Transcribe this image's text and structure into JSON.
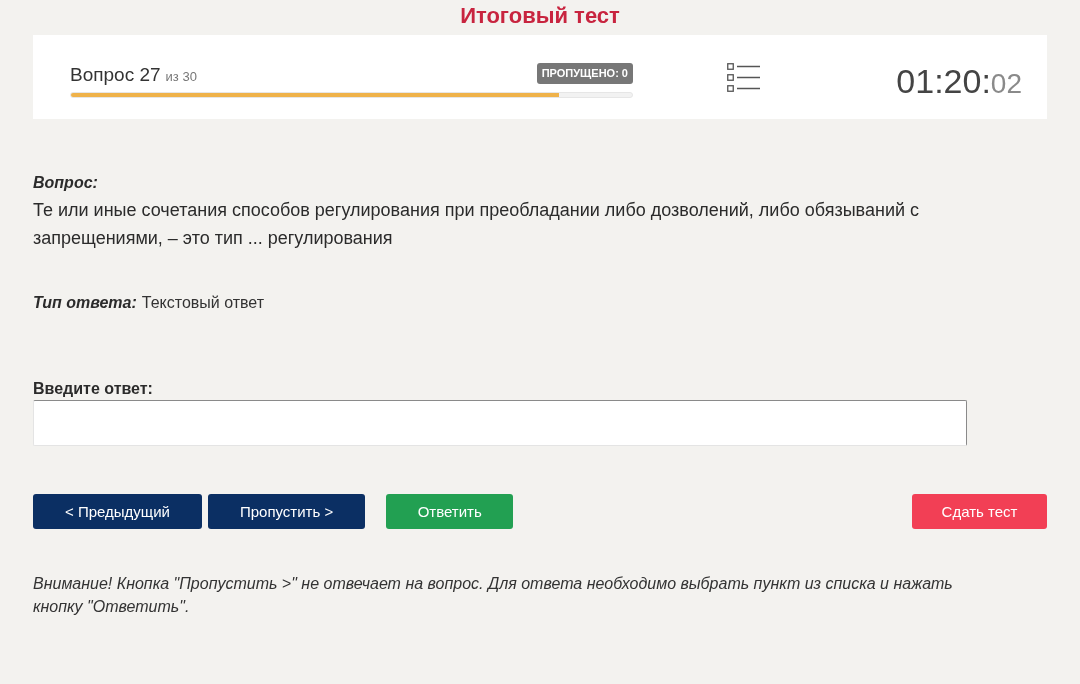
{
  "page_title": "Итоговый тест",
  "header": {
    "question_label": "Вопрос 27",
    "question_total": "из 30",
    "skipped_badge": "ПРОПУЩЕНО: 0",
    "progress": {
      "level": 0.87
    },
    "timer": {
      "main": "01:20:",
      "seconds": "02"
    }
  },
  "question": {
    "label": "Вопрос:",
    "text": "Те или иные сочетания способов регулирования при преобладании либо дозволений, либо обязываний с запрещениями, – это тип ... регулирования"
  },
  "answer_type": {
    "label": "Тип ответа:",
    "value": "Текстовый ответ"
  },
  "answer": {
    "label": "Введите ответ:"
  },
  "buttons": [
    {
      "label": "< Предыдущий",
      "kind": "nav"
    },
    {
      "label": "Пропустить >",
      "kind": "nav"
    },
    {
      "label": "Ответить",
      "kind": "submit"
    },
    {
      "label": "Сдать тест",
      "kind": "finish"
    }
  ],
  "notice": "Внимание! Кнопка \"Пропустить >\" не отвечает на вопрос. Для ответа необходимо выбрать пункт из списка и нажать кнопку \"Ответить\"."
}
